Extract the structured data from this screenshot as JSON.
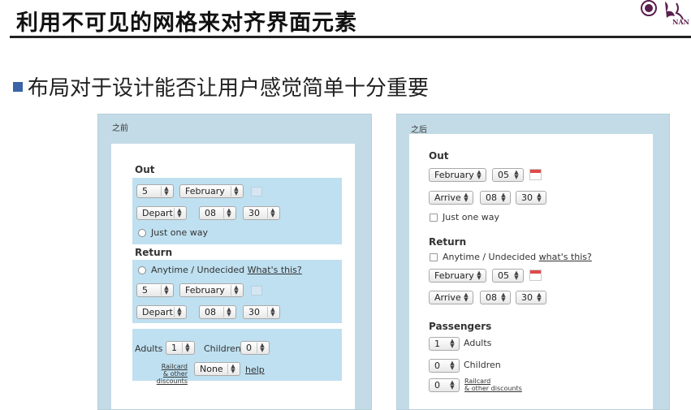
{
  "slide": {
    "title": "利用不可见的网格来对齐界面元素",
    "logo_text": "NAN",
    "bullet": "布局对于设计能否让用户感觉简单十分重要"
  },
  "before": {
    "label": "之前",
    "out": {
      "heading": "Out",
      "day": "5",
      "month": "February",
      "depart": "Depart",
      "hour": "08",
      "minute": "30",
      "just_one_way": "Just one way"
    },
    "return": {
      "heading": "Return",
      "anytime": "Anytime / Undecided",
      "whats_this": "What's this?",
      "day": "5",
      "month": "February",
      "depart": "Depart",
      "hour": "08",
      "minute": "30"
    },
    "passengers": {
      "adults_label": "Adults",
      "adults": "1",
      "children_label": "Children",
      "children": "0",
      "railcard_1": "Railcard",
      "railcard_2": "& other discounts",
      "railcard_value": "None",
      "help": "help"
    }
  },
  "after": {
    "label": "之后",
    "out": {
      "heading": "Out",
      "month": "February",
      "day": "05",
      "arrive": "Arrive",
      "hour": "08",
      "minute": "30",
      "just_one_way": "Just one way"
    },
    "return": {
      "heading": "Return",
      "anytime": "Anytime / Undecided",
      "whats_this": "what's this?",
      "month": "February",
      "day": "05",
      "arrive": "Arrive",
      "hour": "08",
      "minute": "30"
    },
    "passengers": {
      "heading": "Passengers",
      "adults": "1",
      "adults_label": "Adults",
      "children": "0",
      "children_label": "Children",
      "railcard": "0",
      "railcard_1": "Railcard",
      "railcard_2": "& other discounts"
    }
  },
  "colors": {
    "panel_bg": "#c3dbe6",
    "band_bg": "#bfe0f0",
    "accent": "#3a63a8"
  }
}
